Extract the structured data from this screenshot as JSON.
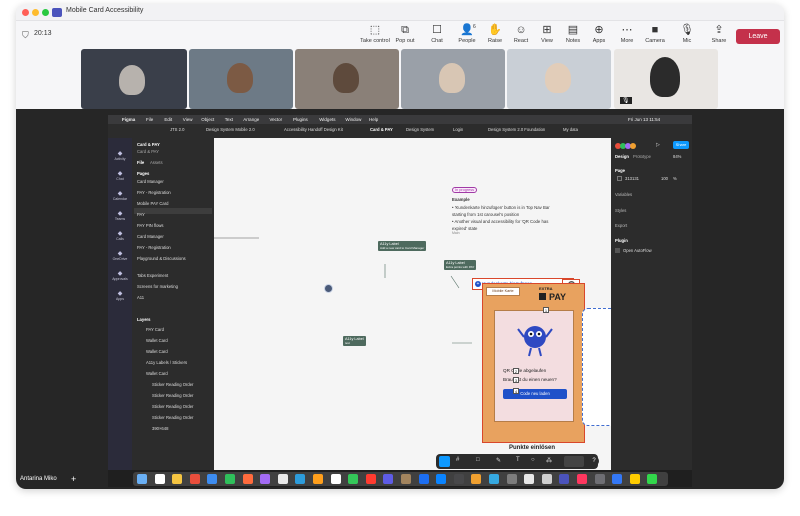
{
  "window": {
    "title": "Mobile Card Accessibility",
    "lights": [
      "#ff5f57",
      "#febc2e",
      "#28c840"
    ]
  },
  "toolbar": {
    "timer": "20:13",
    "buttons": [
      {
        "label": "Take control",
        "icon": "take-control-icon",
        "glyph": "⬚"
      },
      {
        "label": "Pop out",
        "icon": "pop-out-icon",
        "glyph": "⧉"
      },
      {
        "label": "Chat",
        "icon": "chat-icon",
        "glyph": "☐"
      },
      {
        "label": "People",
        "icon": "people-icon",
        "glyph": "👤"
      },
      {
        "label": "Raise",
        "icon": "raise-hand-icon",
        "glyph": "✋"
      },
      {
        "label": "React",
        "icon": "react-icon",
        "glyph": "☺"
      },
      {
        "label": "View",
        "icon": "view-icon",
        "glyph": "⊞"
      },
      {
        "label": "Notes",
        "icon": "notes-icon",
        "glyph": "▤"
      },
      {
        "label": "Apps",
        "icon": "apps-icon",
        "glyph": "⊕"
      },
      {
        "label": "More",
        "icon": "more-icon",
        "glyph": "⋯"
      },
      {
        "label": "Camera",
        "icon": "camera-icon",
        "glyph": "■"
      },
      {
        "label": "Mic",
        "icon": "mic-icon",
        "glyph": "🎙"
      },
      {
        "label": "Share",
        "icon": "share-icon",
        "glyph": "⇪"
      }
    ],
    "people_count": "6",
    "leave_label": "Leave"
  },
  "presenter": {
    "name": "Antarina Miko",
    "add": "+"
  },
  "mac_menu": {
    "app": "Figma",
    "items": [
      "File",
      "Edit",
      "View",
      "Object",
      "Text",
      "Arrange",
      "Vector",
      "Plugins",
      "Widgets",
      "Window",
      "Help"
    ],
    "clock": "Fri Jun 13  11:54"
  },
  "figma_tabs": [
    "JTS 2.0",
    "Design System Mobile 2.0",
    "Accessibility Handoff Design Kit",
    "Card & PAY",
    "Design System",
    "Login",
    "Design System 2.0 Foundation",
    "My data"
  ],
  "teams_sidebar": [
    "Activity",
    "Chat",
    "Calendar",
    "Teams",
    "Calls",
    "OneDrive",
    "Approvals",
    "Apps"
  ],
  "left_panel": {
    "file_title": "Card & PAY",
    "file_sub": "Card & PAY",
    "tabs": [
      "File",
      "Assets"
    ],
    "pages_label": "Pages",
    "pages": [
      "Card Manager",
      "PAY - Registration",
      "Mobile PAY Card",
      "PAY",
      "PAY PIN flows",
      "Card Manager",
      "PAY - Registration",
      "Playground & Discussions",
      "Tabs Experiment",
      "Screens for marketing",
      "A11"
    ],
    "layers_label": "Layers",
    "layers": [
      "PAY Card",
      "Wallet Card",
      "Wallet Card",
      "A11y Labels / Stickers",
      "Wallet Card",
      "Sticker Reading Order",
      "Sticker Reading Order",
      "Sticker Reading Order",
      "Sticker Reading Order",
      "390×648"
    ]
  },
  "canvas": {
    "badge": "In progress",
    "note_heading": "Example",
    "note_lines": [
      "• 'Kundenkarte hinzufügen' button is in Top Nav Bar",
      "  starting from 1st carousel's position",
      "• Another visual and accessibility for 'QR Code has",
      "  expired' state"
    ],
    "frame_label": "Main",
    "a11y_labels": [
      {
        "title": "A11y Label",
        "text": "Add a new card to Card Manager"
      },
      {
        "title": "A11y Label",
        "text": "Extra points with PAY"
      },
      {
        "title": "A11y Label",
        "text": "text"
      }
    ],
    "card": {
      "button": "Kundenkarte hinzufügen",
      "tab_label": "Mobile Karte",
      "brand_top": "EXTRA",
      "brand_pay": "PAY",
      "qr_title": "QR Code abgelaufen",
      "qr_sub": "Brauchst du einen neuen?",
      "cta": "Code neu laden",
      "bottom_text": "Punkte einlösen",
      "markers": [
        "1",
        "2",
        "3",
        "4"
      ]
    },
    "empty_card_plus": "+"
  },
  "right_panel": {
    "tabs": [
      "Design",
      "Prototype"
    ],
    "zoom": "84%",
    "share": "Share",
    "page_label": "Page",
    "page_color": "313131",
    "page_opacity": "100",
    "sections": [
      "Variables",
      "Styles",
      "Export"
    ],
    "plugin_label": "Plugin",
    "plugin_name": "Open AutoFlow"
  },
  "dock_colors": [
    "#6ab0f5",
    "#ffffff",
    "#f5c542",
    "#e94e3c",
    "#3d8cf0",
    "#2fbf5b",
    "#ff6b3d",
    "#a36bf5",
    "#e9e9e9",
    "#2d9cdb",
    "#ff9f1c",
    "#ffffff",
    "#34c759",
    "#ff3b30",
    "#5e5ce6",
    "#a2845e",
    "#1c6ef2",
    "#0a84ff",
    "#48484a",
    "#f0a030",
    "#36a9e1",
    "#7d7d7d",
    "#e8e8e8",
    "#d0d0d0",
    "#4b53bc",
    "#ff375f",
    "#6e6e73",
    "#3478f6",
    "#ffcc00",
    "#32d74b"
  ]
}
